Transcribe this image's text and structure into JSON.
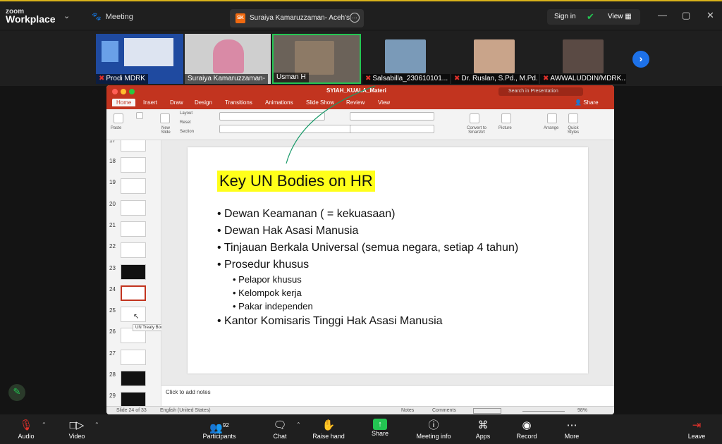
{
  "brand": {
    "line1": "zoom",
    "line2": "Workplace"
  },
  "topbar": {
    "meeting_label": "Meeting",
    "share_tab_initials": "SK",
    "share_tab_title": "Suraiya Kamaruzzaman- Aceh's sc",
    "sign_in": "Sign in",
    "view": "View"
  },
  "participants": [
    {
      "name": "Prodi MDRK"
    },
    {
      "name": "Suraiya Kamaruzzaman-"
    },
    {
      "name": "Usman H"
    },
    {
      "name": "Salsabilla_230610101..."
    },
    {
      "name": "Dr. Ruslan, S.Pd., M.Pd."
    },
    {
      "name": "AWWALUDDIN/MDRK..."
    }
  ],
  "ppt": {
    "file_name": "SYIAH_KUALA_Materi",
    "search_placeholder": "Search in Presentation",
    "tabs": [
      "Home",
      "Insert",
      "Draw",
      "Design",
      "Transitions",
      "Animations",
      "Slide Show",
      "Review",
      "View"
    ],
    "share": "Share",
    "ribbon": {
      "paste": "Paste",
      "new_slide": "New\nSlide",
      "layout": "Layout",
      "reset": "Reset",
      "section": "Section",
      "convert": "Convert to\nSmartArt",
      "picture": "Picture",
      "arrange": "Arrange",
      "quick_styles": "Quick\nStyles"
    },
    "thumbnails": [
      "17",
      "18",
      "19",
      "20",
      "21",
      "22",
      "23",
      "24",
      "25",
      "26",
      "27",
      "28",
      "29"
    ],
    "tooltip": "UN Treaty Bodies",
    "slide": {
      "title": "Key UN Bodies on HR",
      "bullets": [
        "Dewan Keamanan ( = kekuasaan)",
        "Dewan Hak Asasi Manusia",
        "Tinjauan Berkala Universal (semua negara, setiap 4 tahun)",
        "Prosedur khusus"
      ],
      "sub_bullets": [
        "Pelapor khusus",
        "Kelompok kerja",
        "Pakar independen"
      ],
      "last_bullet": "Kantor Komisaris Tinggi Hak Asasi Manusia"
    },
    "notes_placeholder": "Click to add notes",
    "status": {
      "slide": "Slide 24 of 33",
      "lang": "English (United States)",
      "notes": "Notes",
      "comments": "Comments",
      "zoom": "98%"
    }
  },
  "toolbar": {
    "audio": "Audio",
    "video": "Video",
    "participants": "Participants",
    "participant_count": "92",
    "chat": "Chat",
    "raise_hand": "Raise hand",
    "share": "Share",
    "meeting_info": "Meeting info",
    "apps": "Apps",
    "record": "Record",
    "more": "More",
    "leave": "Leave"
  },
  "colors": {
    "accent": "#23c552",
    "ppt_red": "#c2341f",
    "highlight": "#ffff1a"
  }
}
